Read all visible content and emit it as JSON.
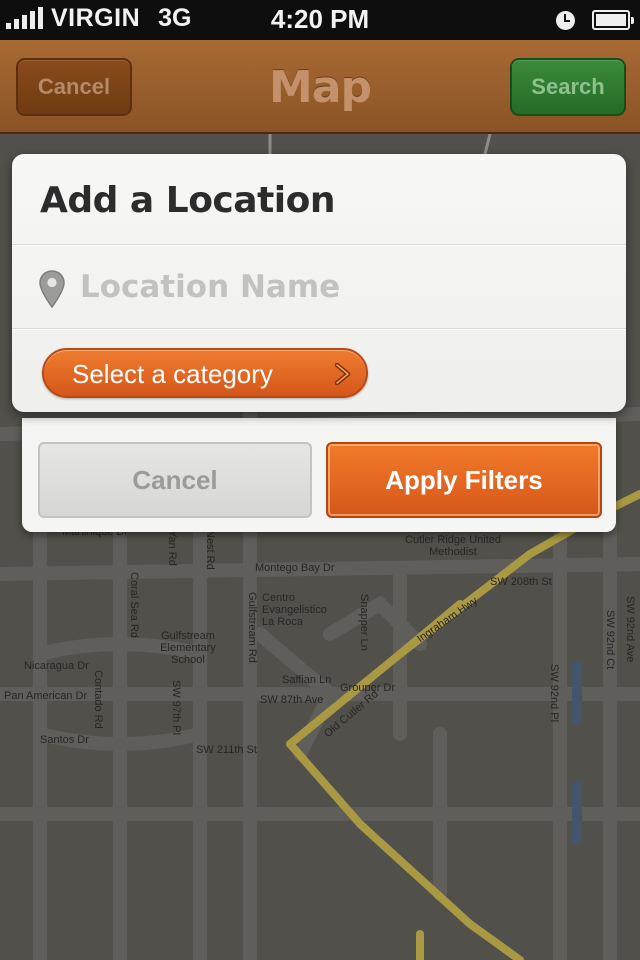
{
  "status_bar": {
    "carrier": "VIRGIN",
    "network": "3G",
    "time": "4:20 PM"
  },
  "nav": {
    "title": "Map",
    "cancel_label": "Cancel",
    "search_label": "Search"
  },
  "dialog": {
    "title": "Add a Location",
    "location_placeholder": "Location Name",
    "location_value": "",
    "category_label": "Select a category",
    "cancel_label": "Cancel",
    "apply_label": "Apply Filters"
  },
  "map": {
    "labels": [
      "Montego Bay Dr",
      "Gulfstream Rd",
      "Coral Sea Rd",
      "Martinique Dr",
      "Centro Evangelistico La Roca",
      "Gulfstream Elementary School",
      "Nicaragua Dr",
      "Pan American Dr",
      "Contado Rd",
      "SW 97th Pl",
      "SW 211th St",
      "Santos Dr",
      "Saffian Ln",
      "Grouper Dr",
      "Snapper Ln",
      "SW 87th Ave",
      "Old Cutler Rd",
      "Ingraham Hwy",
      "SW 208th St",
      "Cutler Ridge United Methodist",
      "SW 92nd Ave",
      "SW 92nd Ct",
      "SW 92nd Pl",
      "Nest Rd",
      "Yan Rd"
    ]
  },
  "colors": {
    "nav_brown": "#9a5e2c",
    "search_green": "#2f7d31",
    "accent_orange": "#e8672a",
    "map_bg": "#5b5954"
  }
}
